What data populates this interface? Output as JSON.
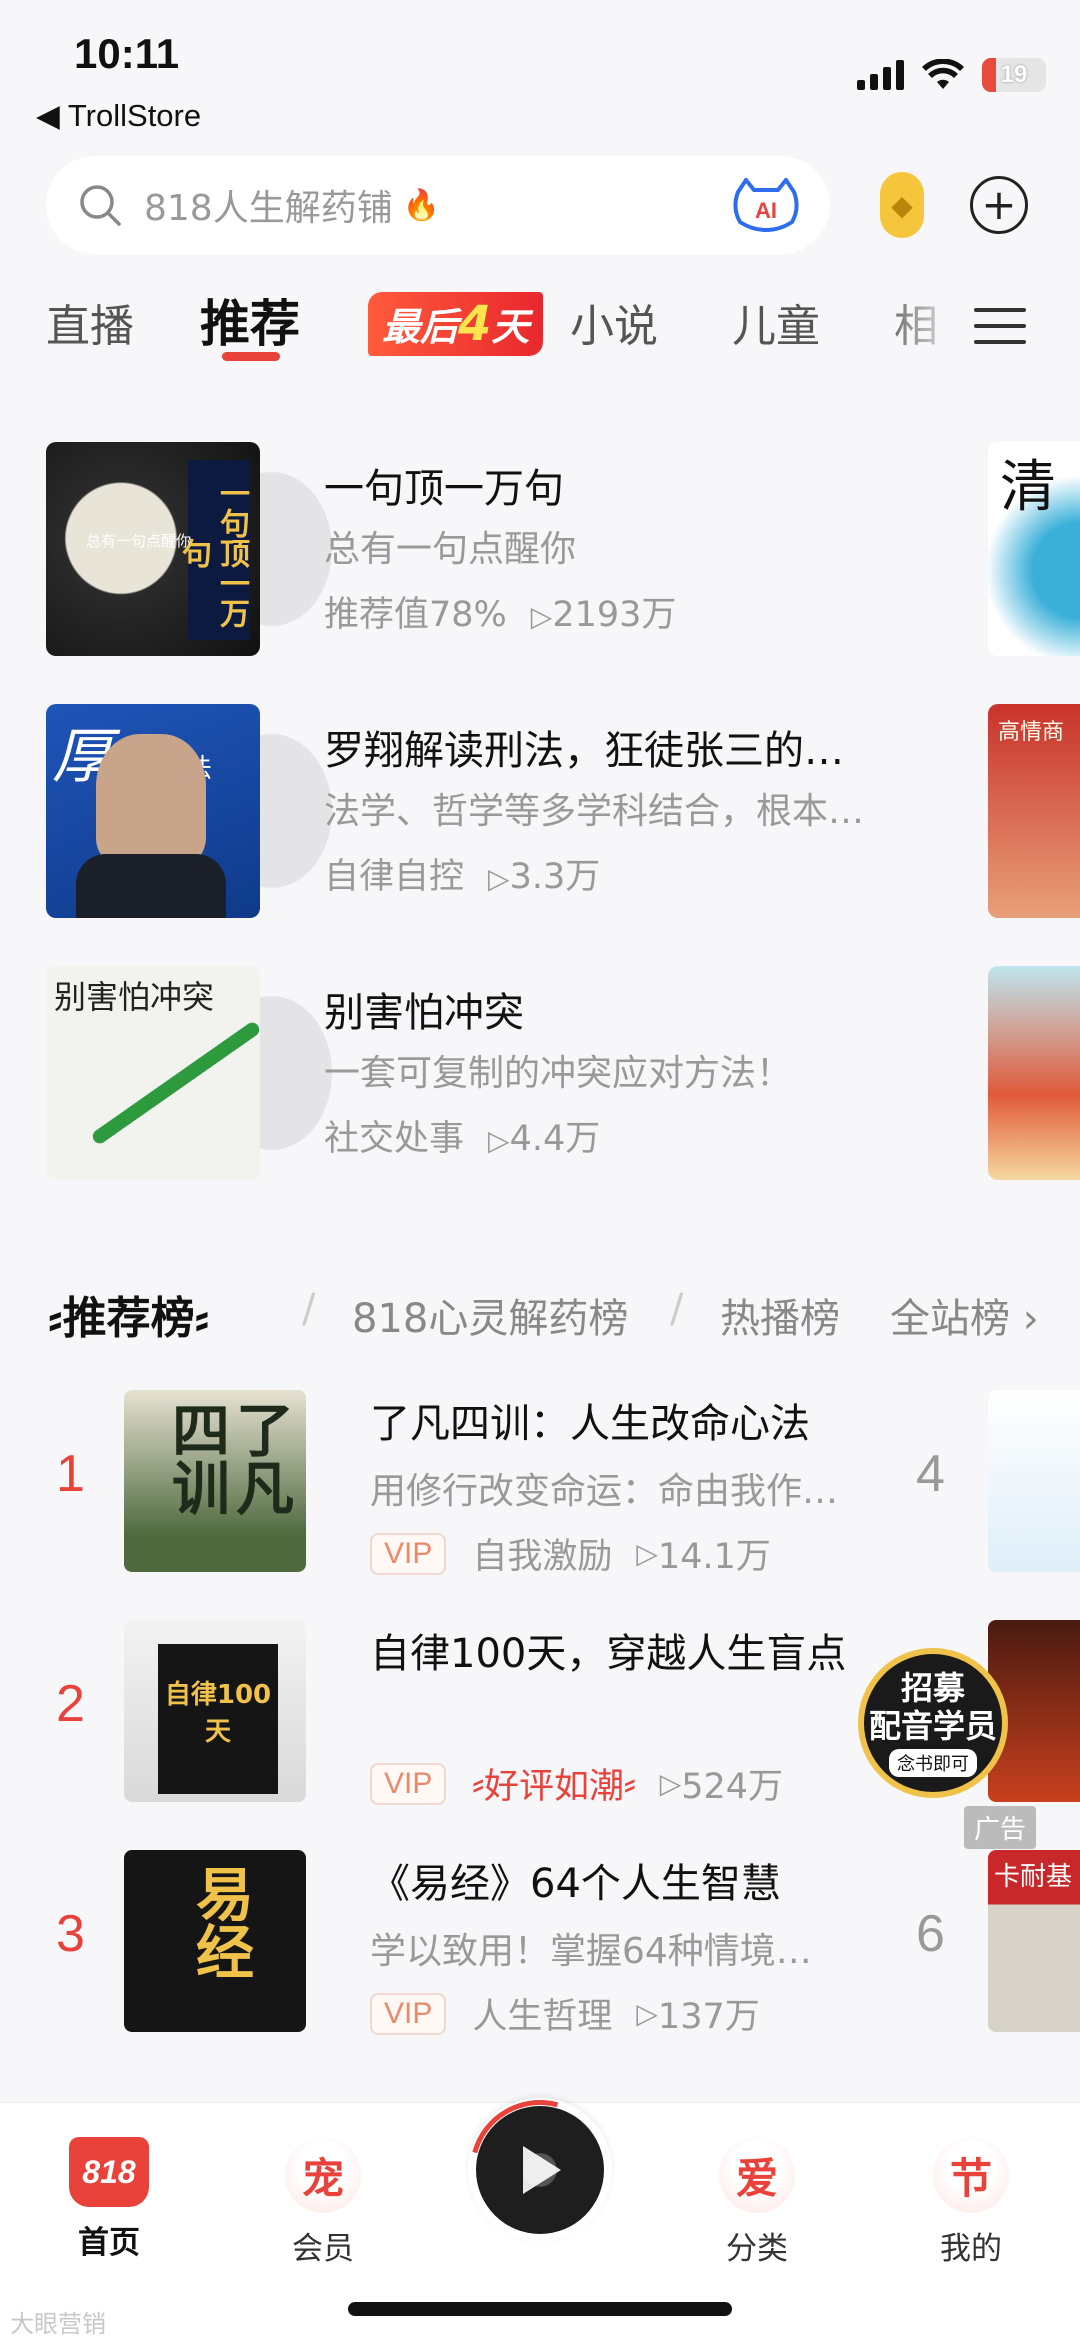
{
  "status_bar": {
    "time": "10:11",
    "back_app": "◀ TrollStore",
    "battery": "19"
  },
  "search": {
    "placeholder": "818人生解药铺",
    "ai_label": "AI"
  },
  "tabs": [
    "直播",
    "推荐",
    "最后4天",
    "小说",
    "儿童",
    "相"
  ],
  "tab_promo": {
    "prefix": "最后",
    "number": "4",
    "suffix": "天"
  },
  "books": [
    {
      "title": "一句顶一万句",
      "subtitle": "总有一句点醒你",
      "tag": "推荐值78%",
      "plays": "2193万",
      "side_title": "清"
    },
    {
      "title": "罗翔解读刑法，狂徒张三的…",
      "subtitle": "法学、哲学等多学科结合，根本…",
      "tag": "自律自控",
      "plays": "3.3万",
      "side_title": "高情商"
    },
    {
      "title": "别害怕冲突",
      "subtitle": "一套可复制的冲突应对方法！",
      "tag": "社交处事",
      "plays": "4.4万",
      "side_title": ""
    }
  ],
  "book_covers": {
    "b1": {
      "line1": "一句顶",
      "line2": "一万句",
      "sub": "总有一句点醒你"
    },
    "b2": {
      "big": "厚",
      "small": "法"
    },
    "b3": {
      "title": "别害怕冲突"
    }
  },
  "ranking": {
    "title": "推荐榜",
    "tabs": [
      "818心灵解药榜",
      "热播榜"
    ],
    "more": "全站榜 ›",
    "items": [
      {
        "rank": "1",
        "title": "了凡四训：人生改命心法",
        "subtitle": "用修行改变命运：命由我作…",
        "badge": "VIP",
        "tag": "自我激励",
        "plays": "14.1万",
        "side_rank": "4"
      },
      {
        "rank": "2",
        "title": "自律100天，穿越人生盲点",
        "subtitle": "",
        "badge": "VIP",
        "tag": "好评如潮",
        "plays": "524万",
        "side_rank": ""
      },
      {
        "rank": "3",
        "title": "《易经》64个人生智慧",
        "subtitle": "学以致用！掌握64种情境…",
        "badge": "VIP",
        "tag": "人生哲理",
        "plays": "137万",
        "side_rank": "6"
      }
    ],
    "covers": {
      "c1": "了凡四训",
      "c2": "自律100天",
      "c3": "易经"
    },
    "side_cover_texts": {
      "s3": "卡耐基"
    }
  },
  "ad": {
    "line1": "招募",
    "line2": "配音学员",
    "line3": "念书即可",
    "label": "广告"
  },
  "bottom_nav": {
    "items": [
      {
        "icon": "818",
        "label": "首页"
      },
      {
        "icon": "宠",
        "label": "会员"
      },
      {
        "icon": "爱",
        "label": "分类"
      },
      {
        "icon": "节",
        "label": "我的"
      }
    ]
  },
  "watermark": "大眼营销",
  "colors": {
    "accent": "#e8423a",
    "gray_text": "#999999",
    "background": "#f7f7f9"
  }
}
